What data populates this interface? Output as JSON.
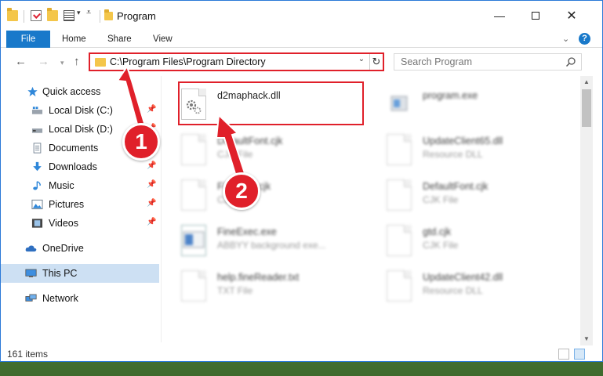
{
  "window": {
    "title": "Program"
  },
  "ribbon": {
    "tabs": [
      "File",
      "Home",
      "Share",
      "View"
    ]
  },
  "address_bar": {
    "path": "C:\\Program Files\\Program Directory"
  },
  "search": {
    "placeholder": "Search Program"
  },
  "sidebar": {
    "items": [
      {
        "label": "Quick access",
        "icon": "star-icon",
        "pinned": false
      },
      {
        "label": "Local Disk (C:)",
        "icon": "disk-icon",
        "pinned": true
      },
      {
        "label": "Local Disk (D:)",
        "icon": "disk-icon",
        "pinned": true
      },
      {
        "label": "Documents",
        "icon": "documents-icon",
        "pinned": true
      },
      {
        "label": "Downloads",
        "icon": "downloads-icon",
        "pinned": true
      },
      {
        "label": "Music",
        "icon": "music-icon",
        "pinned": true
      },
      {
        "label": "Pictures",
        "icon": "pictures-icon",
        "pinned": true
      },
      {
        "label": "Videos",
        "icon": "videos-icon",
        "pinned": true
      },
      {
        "label": "OneDrive",
        "icon": "cloud-icon",
        "pinned": false
      },
      {
        "label": "This PC",
        "icon": "computer-icon",
        "pinned": false,
        "selected": true
      },
      {
        "label": "Network",
        "icon": "network-icon",
        "pinned": false
      }
    ]
  },
  "files": [
    {
      "name": "d2maphack.dll",
      "type": "",
      "highlighted": true
    },
    {
      "name": "program.exe",
      "type": ""
    },
    {
      "name": "DefaultFont.cjk",
      "type": "CJK File"
    },
    {
      "name": "UpdateClient65.dll",
      "type": "Resource DLL"
    },
    {
      "name": "FineFont.cjk",
      "type": "CJK File"
    },
    {
      "name": "DefaultFont.cjk",
      "type": "CJK File"
    },
    {
      "name": "FineExec.exe",
      "type": "ABBYY background exe..."
    },
    {
      "name": "gtd.cjk",
      "type": "CJK File"
    },
    {
      "name": "help.fineReader.txt",
      "type": "TXT File"
    },
    {
      "name": "UpdateClient42.dll",
      "type": "Resource DLL"
    }
  ],
  "status": {
    "item_count": "161 items"
  },
  "callouts": [
    "1",
    "2"
  ],
  "colors": {
    "accent": "#1979ca",
    "highlight": "#e0202a",
    "selected": "#cde0f3"
  }
}
